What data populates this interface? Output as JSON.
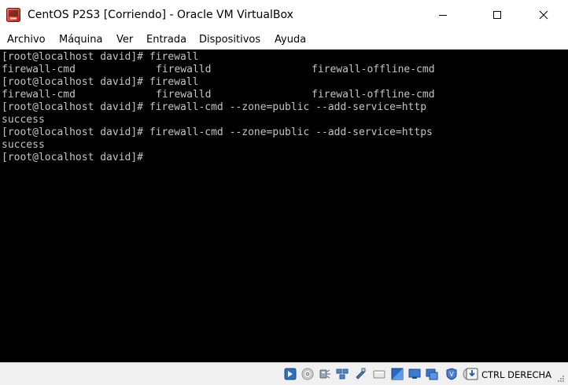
{
  "window": {
    "title": "CentOS P2S3 [Corriendo] - Oracle VM VirtualBox",
    "app_icon": "virtualbox-icon",
    "controls": [
      "minimize-icon",
      "maximize-icon",
      "close-icon"
    ]
  },
  "menu": {
    "items": [
      "Archivo",
      "Máquina",
      "Ver",
      "Entrada",
      "Dispositivos",
      "Ayuda"
    ]
  },
  "terminal": {
    "background": "#000000",
    "foreground": "#c4c4c4",
    "lines": [
      {
        "cols": [
          "[root@localhost david]# firewall"
        ]
      },
      {
        "cols": [
          "firewall-cmd",
          "firewalld",
          "firewall-offline-cmd"
        ]
      },
      {
        "cols": [
          "[root@localhost david]# firewall"
        ]
      },
      {
        "cols": [
          "firewall-cmd",
          "firewalld",
          "firewall-offline-cmd"
        ]
      },
      {
        "cols": [
          "[root@localhost david]# firewall-cmd --zone=public --add-service=http"
        ]
      },
      {
        "cols": [
          "success"
        ]
      },
      {
        "cols": [
          "[root@localhost david]# firewall-cmd --zone=public --add-service=https"
        ]
      },
      {
        "cols": [
          "success"
        ]
      },
      {
        "cols": [
          "[root@localhost david]#"
        ]
      }
    ]
  },
  "statusbar": {
    "icons": [
      "hard-disk-icon",
      "optical-drive-icon",
      "audio-icon",
      "network-icon",
      "usb-icon",
      "shared-folders-icon",
      "display-icon",
      "video-capture-icon",
      "virtualization-icon",
      "mouse-integration-icon",
      "keyboard-capture-icon"
    ],
    "host_key": "CTRL DERECHA"
  }
}
